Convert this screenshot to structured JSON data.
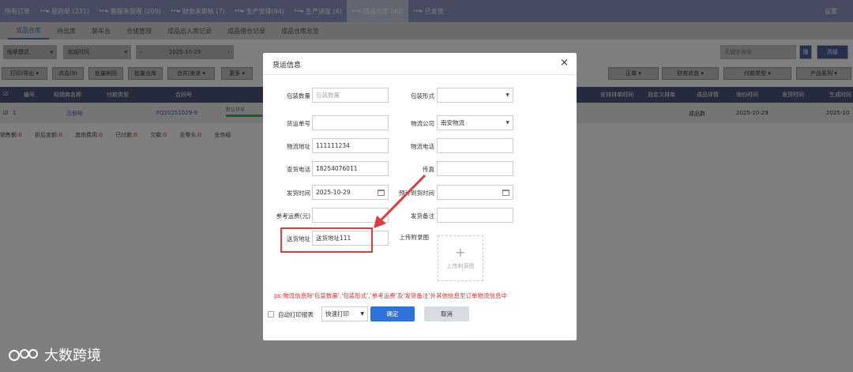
{
  "topnav": {
    "items": [
      "所有订单",
      "意向单 (231)",
      "客服未受理 (209)",
      "财务未审核 (7)",
      "生产安排(94)",
      "生产进度 (4)",
      "成品仓库 (40)",
      "已发货"
    ],
    "settings": "设置"
  },
  "subtabs": [
    "成品仓库",
    "待出库",
    "装车台",
    "仓储管理",
    "成品出入库记录",
    "成品借仓记录",
    "成品仓库总览"
  ],
  "filters": {
    "mode": "细单模式",
    "time_type": "询减时间",
    "date": "2025-10-29",
    "keyword_placeholder": "关键字搜索",
    "search_btn": "搜",
    "advanced_btn": "高级"
  },
  "toolbar": {
    "buttons": [
      "打印/导出",
      "点击(9)",
      "批量刷回",
      "批量出库",
      "合并/发货",
      "更多"
    ],
    "right_selects": [
      "正单",
      "财务状态",
      "付款类型",
      "产品系列"
    ]
  },
  "table": {
    "headers": [
      "编号",
      "经销商名称",
      "付款类型",
      "合同号",
      "安排排单时间",
      "自定义排单",
      "成品详情",
      "询价时间",
      "发货时间",
      "生成时间"
    ],
    "row": {
      "num": "1",
      "dealer": "示例号",
      "contract": "FQ20251029-9",
      "status": "默认环节",
      "detail": "成品数",
      "inquiry_time": "2025-10-29",
      "gen_time": "2025-10"
    }
  },
  "summary": [
    {
      "label": "销售额:",
      "value": "0"
    },
    {
      "label": "折后金额:",
      "value": "0"
    },
    {
      "label": "其他费用:",
      "value": "0"
    },
    {
      "label": "已付款:",
      "value": "0"
    },
    {
      "label": "欠款:",
      "value": "0"
    },
    {
      "label": "去零头:",
      "value": "0"
    },
    {
      "label": "业务结",
      "value": ""
    }
  ],
  "modal": {
    "title": "货运信息",
    "close": "×",
    "fields": {
      "pkg_count": {
        "label": "包装数量",
        "placeholder": "包装数量"
      },
      "pkg_form": {
        "label": "包装形式",
        "value": ""
      },
      "ship_no": {
        "label": "货运单号",
        "value": ""
      },
      "logistics_co": {
        "label": "物流公司",
        "value": "南安物流"
      },
      "logistics_addr": {
        "label": "物流地址",
        "value": "111111234"
      },
      "logistics_phone": {
        "label": "物流电话",
        "value": ""
      },
      "query_phone": {
        "label": "查货电话",
        "value": "18254076011"
      },
      "fax": {
        "label": "传真",
        "value": ""
      },
      "ship_time": {
        "label": "发货时间",
        "value": "2025-10-29"
      },
      "eta": {
        "label": "预计到货时间",
        "value": ""
      },
      "ref_freight": {
        "label": "参考运费(元)",
        "value": ""
      },
      "ship_note": {
        "label": "发货备注",
        "value": ""
      },
      "delivery_addr": {
        "label": "送货地址",
        "value": "送货地址111"
      },
      "attachment": {
        "label": "上传附录图",
        "button": "上传附录图",
        "plus": "+"
      }
    },
    "note": "ps:物流信息除'包装数量','包装形式','参考运费'及'发货备注'外其他信息至订单物流信息中",
    "auto_print": "自动打印报表",
    "print_mode": "快速打印",
    "ok": "确定",
    "cancel": "取消"
  },
  "watermark": "大数跨境",
  "colors": {
    "accent": "#2d73d9",
    "highlight": "#e13b3b",
    "note": "#e03030",
    "nav": "#8d97c5"
  }
}
